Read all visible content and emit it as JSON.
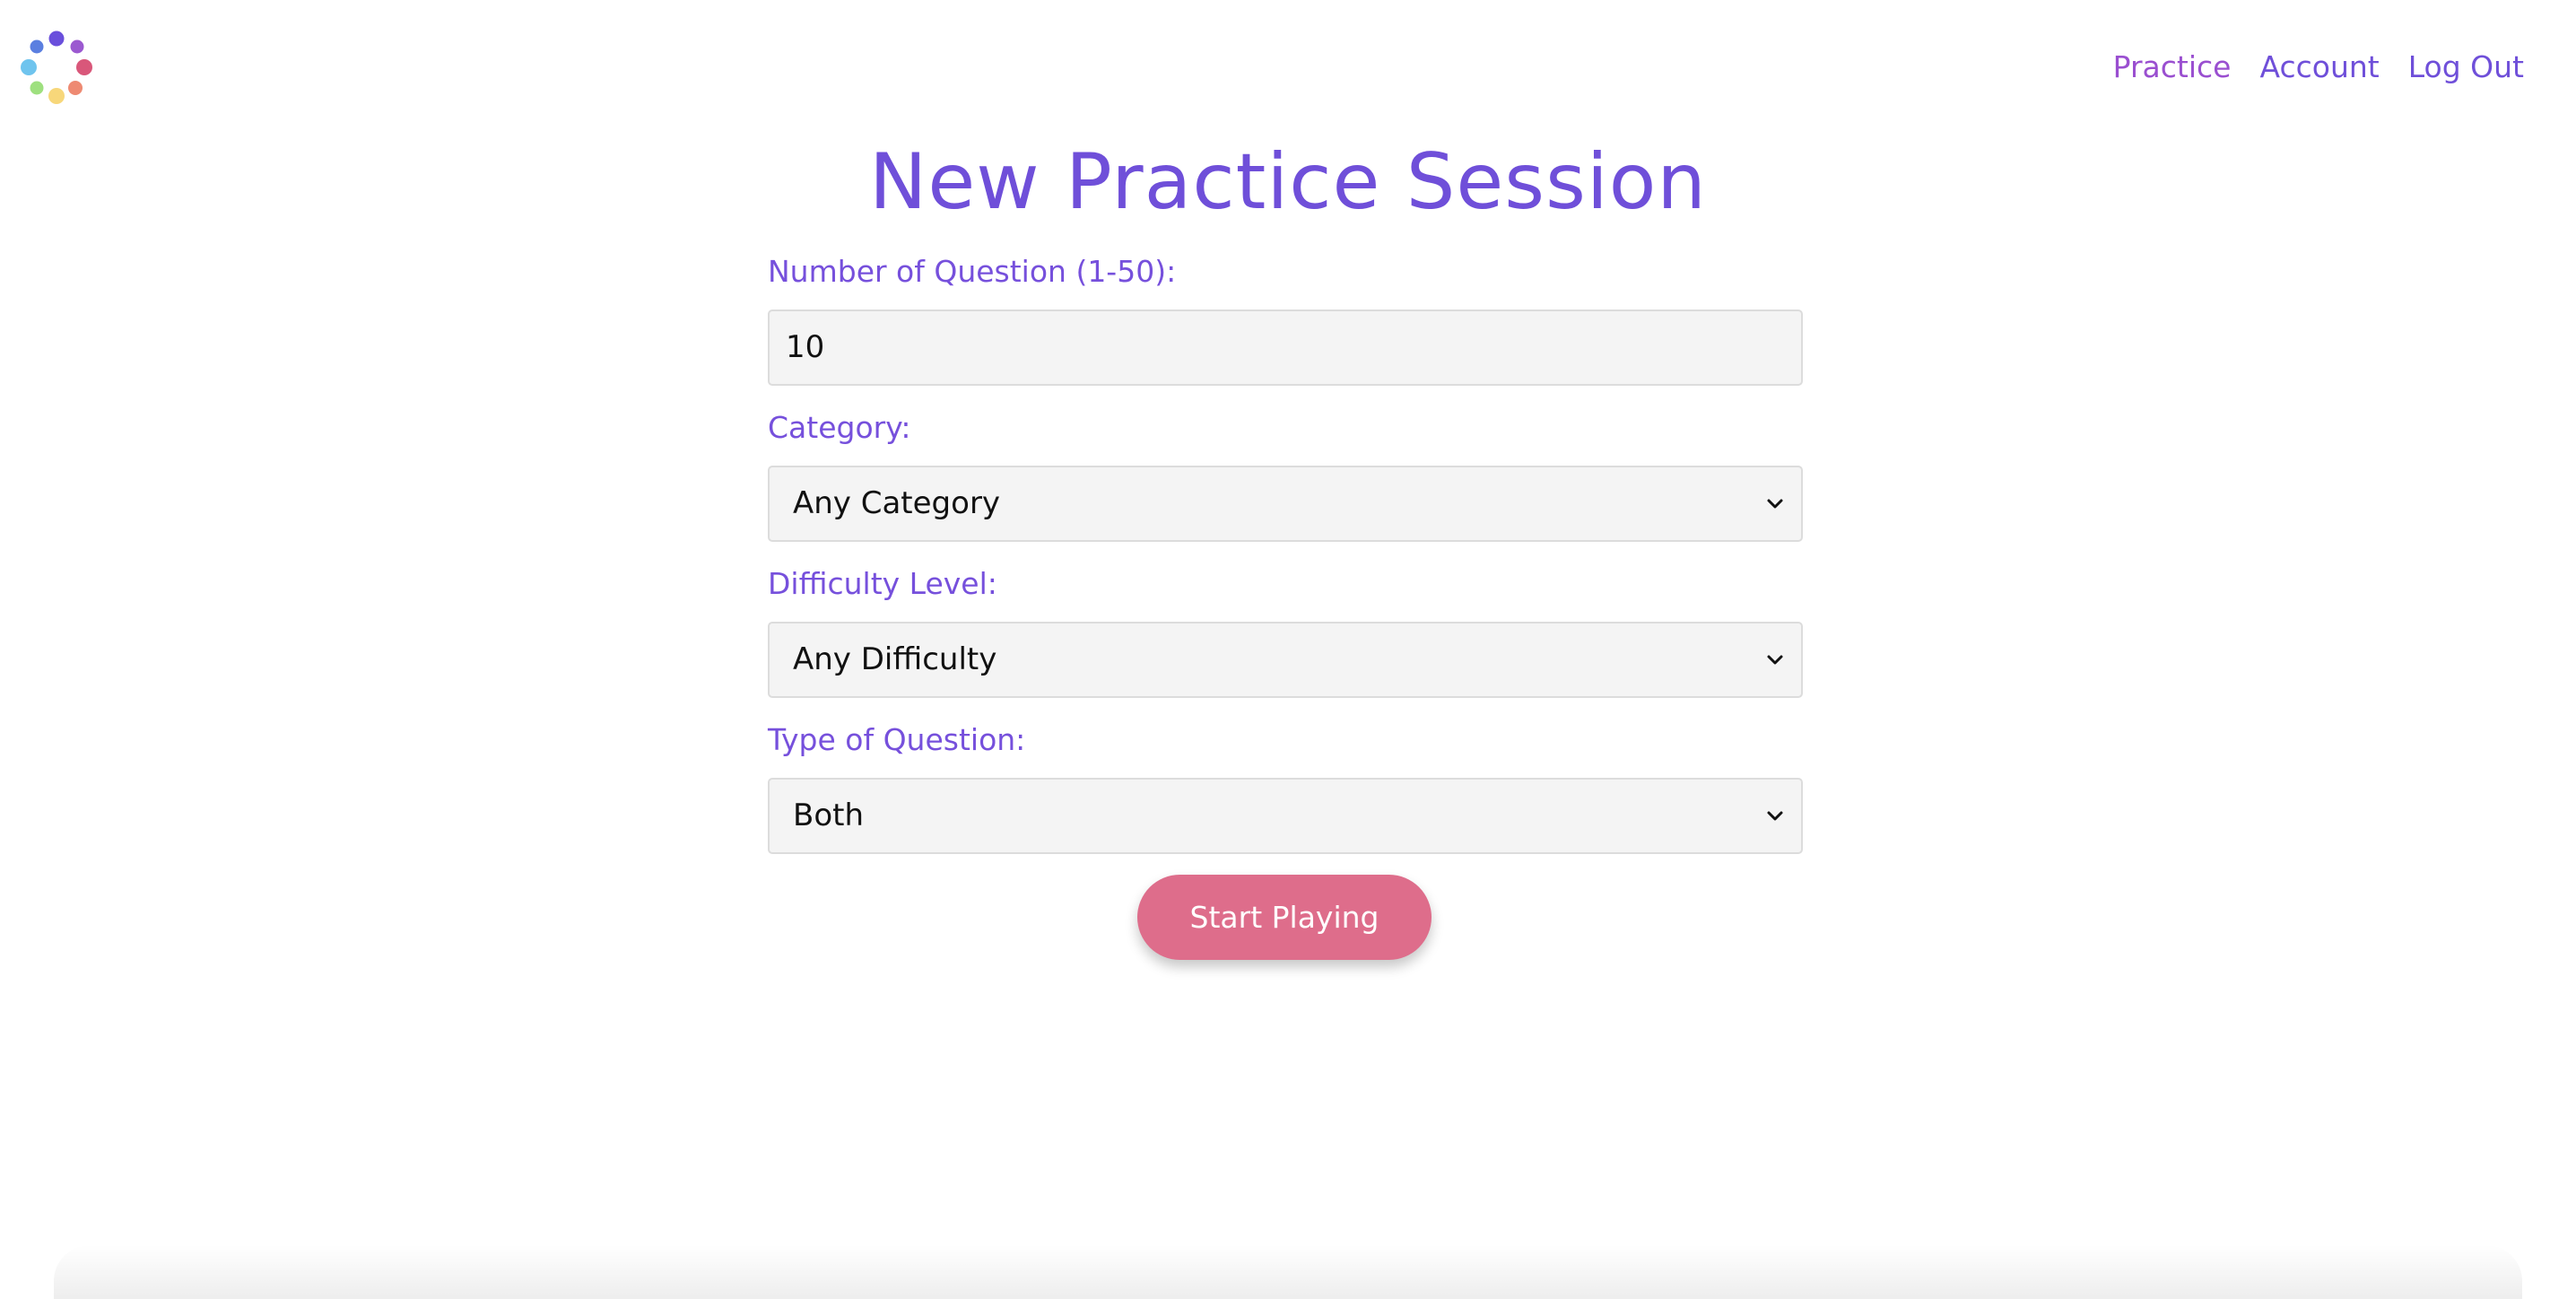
{
  "logo": {
    "icon": "dots-circle-logo-icon"
  },
  "nav": {
    "items": [
      {
        "label": "Practice",
        "active": true
      },
      {
        "label": "Account",
        "active": false
      },
      {
        "label": "Log Out",
        "active": false
      }
    ]
  },
  "page_title": "New Practice Session",
  "form": {
    "num_questions": {
      "label": "Number of Question (1-50):",
      "value": "10"
    },
    "category": {
      "label": "Category:",
      "selected": "Any Category"
    },
    "difficulty": {
      "label": "Difficulty Level:",
      "selected": "Any Difficulty"
    },
    "type": {
      "label": "Type of Question:",
      "selected": "Both"
    }
  },
  "start_button": {
    "label": "Start Playing"
  },
  "colors": {
    "primary": "#6f4fd9",
    "nav_active": "#9a4fd0",
    "button": "#de6d8b",
    "field_bg": "#f4f4f4",
    "logo_dots": [
      "#6a4fdc",
      "#9b59d0",
      "#d9577a",
      "#ee8a72",
      "#f7d77a",
      "#9ee07f",
      "#6fc4ee",
      "#5b7fe0"
    ]
  }
}
